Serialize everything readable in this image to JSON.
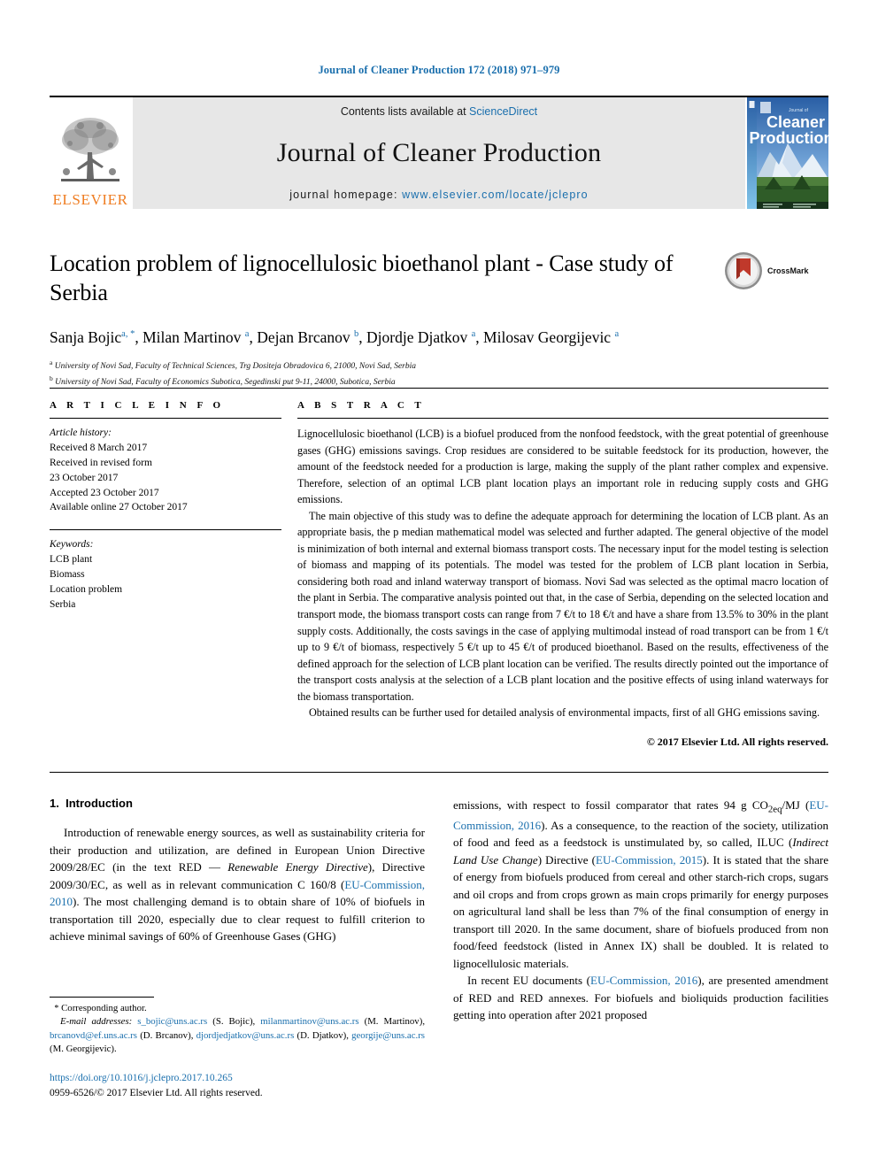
{
  "running_head": "Journal of Cleaner Production 172 (2018) 971–979",
  "masthead": {
    "publisher_name": "ELSEVIER",
    "contents_prefix": "Contents lists available at ",
    "contents_link": "ScienceDirect",
    "journal_title": "Journal of Cleaner Production",
    "homepage_prefix": "journal homepage: ",
    "homepage_url": "www.elsevier.com/locate/jclepro",
    "cover_title_small": "Journal of",
    "cover_title_line1": "Cleaner",
    "cover_title_line2": "Production"
  },
  "article": {
    "title": "Location problem of lignocellulosic bioethanol plant - Case study of Serbia",
    "crossmark_label": "CrossMark",
    "authors": [
      {
        "name": "Sanja Bojic",
        "marks": "a, *"
      },
      {
        "name": "Milan Martinov",
        "marks": "a"
      },
      {
        "name": "Dejan Brcanov",
        "marks": "b"
      },
      {
        "name": "Djordje Djatkov",
        "marks": "a"
      },
      {
        "name": "Milosav Georgijevic",
        "marks": "a"
      }
    ],
    "affiliations": [
      {
        "mark": "a",
        "text": "University of Novi Sad, Faculty of Technical Sciences, Trg Dositeja Obradovica 6, 21000, Novi Sad, Serbia"
      },
      {
        "mark": "b",
        "text": "University of Novi Sad, Faculty of Economics Subotica, Segedinski put 9-11, 24000, Subotica, Serbia"
      }
    ]
  },
  "article_info": {
    "heading": "A R T I C L E   I N F O",
    "history_label": "Article history:",
    "history": [
      "Received 8 March 2017",
      "Received in revised form",
      "23 October 2017",
      "Accepted 23 October 2017",
      "Available online 27 October 2017"
    ],
    "keywords_label": "Keywords:",
    "keywords": [
      "LCB plant",
      "Biomass",
      "Location problem",
      "Serbia"
    ]
  },
  "abstract": {
    "heading": "A B S T R A C T",
    "paragraphs": [
      "Lignocellulosic bioethanol (LCB) is a biofuel produced from the nonfood feedstock, with the great potential of greenhouse gases (GHG) emissions savings. Crop residues are considered to be suitable feedstock for its production, however, the amount of the feedstock needed for a production is large, making the supply of the plant rather complex and expensive. Therefore, selection of an optimal LCB plant location plays an important role in reducing supply costs and GHG emissions.",
      "The main objective of this study was to define the adequate approach for determining the location of LCB plant. As an appropriate basis, the p median mathematical model was selected and further adapted. The general objective of the model is minimization of both internal and external biomass transport costs. The necessary input for the model testing is selection of biomass and mapping of its potentials. The model was tested for the problem of LCB plant location in Serbia, considering both road and inland waterway transport of biomass. Novi Sad was selected as the optimal macro location of the plant in Serbia. The comparative analysis pointed out that, in the case of Serbia, depending on the selected location and transport mode, the biomass transport costs can range from 7 €/t to 18 €/t and have a share from 13.5% to 30% in the plant supply costs. Additionally, the costs savings in the case of applying multimodal instead of road transport can be from 1 €/t up to 9 €/t of biomass, respectively 5 €/t up to 45 €/t of produced bioethanol. Based on the results, effectiveness of the defined approach for the selection of LCB plant location can be verified. The results directly pointed out the importance of the transport costs analysis at the selection of a LCB plant location and the positive effects of using inland waterways for the biomass transportation.",
      "Obtained results can be further used for detailed analysis of environmental impacts, first of all GHG emissions saving."
    ],
    "copyright": "© 2017 Elsevier Ltd. All rights reserved."
  },
  "introduction": {
    "number": "1.",
    "heading": "Introduction",
    "left_col": [
      "Introduction of renewable energy sources, as well as sustainability criteria for their production and utilization, are defined in European Union Directive 2009/28/EC (in the text RED — ",
      "Renewable Energy Directive",
      "), Directive 2009/30/EC, as well as in relevant communication C 160/8 (",
      "EU-Commission, 2010",
      "). The most challenging demand is to obtain share of 10% of biofuels in transportation till 2020, especially due to clear request to fulfill criterion to achieve minimal savings of 60% of Greenhouse Gases (GHG)"
    ],
    "right_col_p1": [
      "emissions, with respect to fossil comparator that rates 94 g CO",
      "2eq",
      "/MJ (",
      "EU-Commission, 2016",
      "). As a consequence, to the reaction of the society, utilization of food and feed as a feedstock is unstimulated by, so called, ILUC (",
      "Indirect Land Use Change",
      ") Directive (",
      "EU-Commission, 2015",
      "). It is stated that the share of energy from biofuels produced from cereal and other starch-rich crops, sugars and oil crops and from crops grown as main crops primarily for energy purposes on agricultural land shall be less than 7% of the final consumption of energy in transport till 2020. In the same document, share of biofuels produced from non food/feed feedstock (listed in Annex IX) shall be doubled. It is related to lignocellulosic materials."
    ],
    "right_col_p2": [
      "In recent EU documents (",
      "EU-Commission, 2016",
      "), are presented amendment of RED and RED annexes. For biofuels and bioliquids production facilities getting into operation after 2021 proposed"
    ]
  },
  "footnote": {
    "corresponding_author": "Corresponding author.",
    "email_label": "E-mail addresses:",
    "emails": [
      {
        "address": "s_bojic@uns.ac.rs",
        "person": "(S. Bojic)"
      },
      {
        "address": "milanmartinov@uns.ac.rs",
        "person": "(M. Martinov)"
      },
      {
        "address": "brcanovd@ef.uns.ac.rs",
        "person": "(D. Brcanov)"
      },
      {
        "address": "djordjedjatkov@uns.ac.rs",
        "person": "(D. Djatkov)"
      },
      {
        "address": "georgije@uns.ac.rs",
        "person": "(M. Georgijevic)"
      }
    ],
    "doi": "https://doi.org/10.1016/j.jclepro.2017.10.265",
    "issn_line": "0959-6526/© 2017 Elsevier Ltd. All rights reserved."
  },
  "colors": {
    "link_blue": "#1a6fad",
    "elsevier_orange": "#ef7d22",
    "masthead_gray": "#e7e7e7"
  }
}
